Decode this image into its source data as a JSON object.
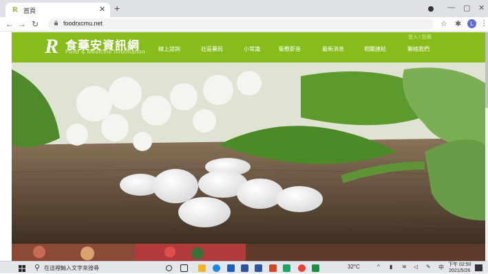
{
  "browser": {
    "tab_title": "首頁",
    "tab_favicon": "R",
    "url": "foodrxcmu.net",
    "profile_initial": "L"
  },
  "site": {
    "logo_rx": "R",
    "logo_cn": "食藥安資訊網",
    "logo_en": "Food & Medicine Information",
    "user_links": "登入 / 註冊",
    "nav": [
      "線上諮詢",
      "社區藥局",
      "小常識",
      "衛教影音",
      "最新消息",
      "相關連結",
      "聯絡我們"
    ]
  },
  "taskbar": {
    "search_placeholder": "在這裡輸入文字來搜尋",
    "weather": "32°C",
    "ime": "中",
    "time": "下午 02:50",
    "date": "2021/5/26"
  },
  "colors": {
    "brand_green": "#86bd1b"
  }
}
